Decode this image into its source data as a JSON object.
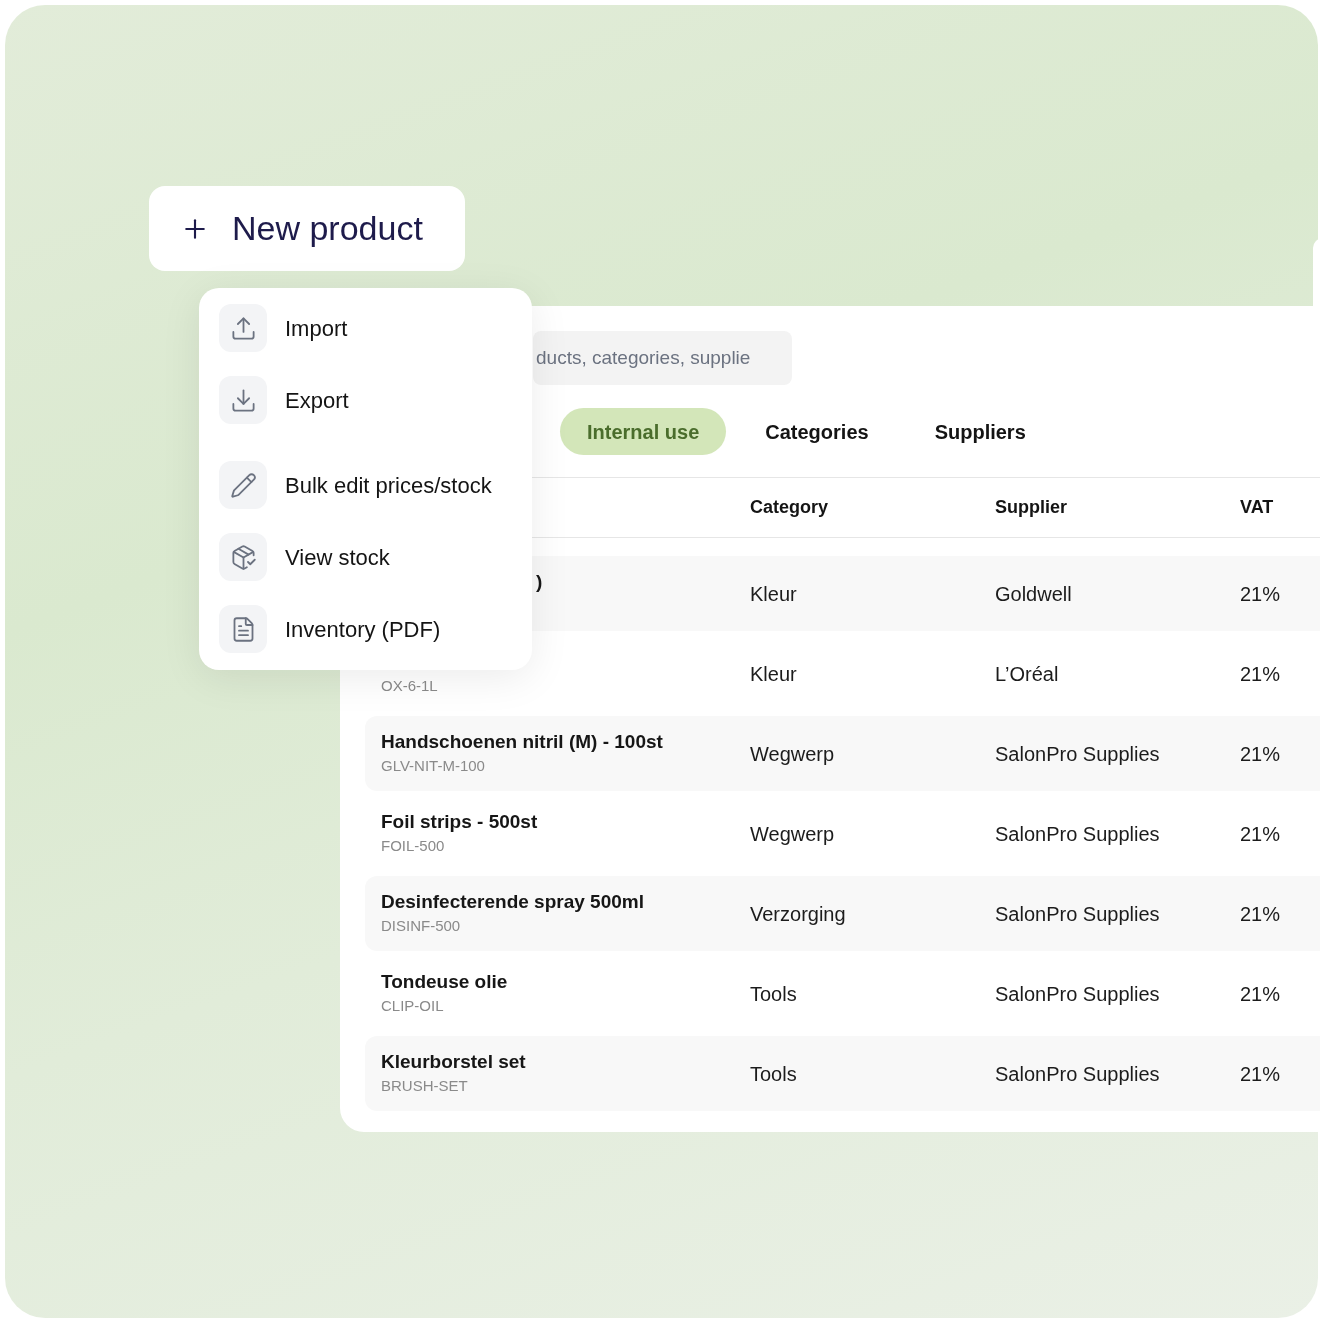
{
  "new_product_button": {
    "label": "New product"
  },
  "menu": {
    "groups": [
      [
        {
          "kind": "import",
          "label": "Import"
        },
        {
          "kind": "export",
          "label": "Export"
        }
      ],
      [
        {
          "kind": "bulk_edit",
          "label": "Bulk edit prices/stock"
        },
        {
          "kind": "view_stock",
          "label": "View stock"
        },
        {
          "kind": "inventory",
          "label": "Inventory (PDF)"
        }
      ]
    ]
  },
  "search": {
    "placeholder": "ducts, categories, supplie"
  },
  "tabs": [
    {
      "label": "Internal use",
      "selected": true
    },
    {
      "label": "Categories",
      "selected": false
    },
    {
      "label": "Suppliers",
      "selected": false
    }
  ],
  "table": {
    "columns": [
      "Category",
      "Supplier",
      "VAT"
    ],
    "rows": [
      {
        "kind": "covered",
        "name": ")",
        "category": "Kleur",
        "supplier": "Goldwell",
        "vat": "21%"
      },
      {
        "kind": "covered",
        "sku": "OX-6-1L",
        "category": "Kleur",
        "supplier": "L’Oréal",
        "vat": "21%"
      },
      {
        "kind": "item",
        "name": "Handschoenen nitril (M) - 100st",
        "sku": "GLV-NIT-M-100",
        "category": "Wegwerp",
        "supplier": "SalonPro Supplies",
        "vat": "21%"
      },
      {
        "kind": "item",
        "name": "Foil strips - 500st",
        "sku": "FOIL-500",
        "category": "Wegwerp",
        "supplier": "SalonPro Supplies",
        "vat": "21%"
      },
      {
        "kind": "item",
        "name": "Desinfecterende spray 500ml",
        "sku": "DISINF-500",
        "category": "Verzorging",
        "supplier": "SalonPro Supplies",
        "vat": "21%"
      },
      {
        "kind": "item",
        "name": "Tondeuse olie",
        "sku": "CLIP-OIL",
        "category": "Tools",
        "supplier": "SalonPro Supplies",
        "vat": "21%"
      },
      {
        "kind": "item",
        "name": "Kleurborstel set",
        "sku": "BRUSH-SET",
        "category": "Tools",
        "supplier": "SalonPro Supplies",
        "vat": "21%"
      }
    ]
  }
}
